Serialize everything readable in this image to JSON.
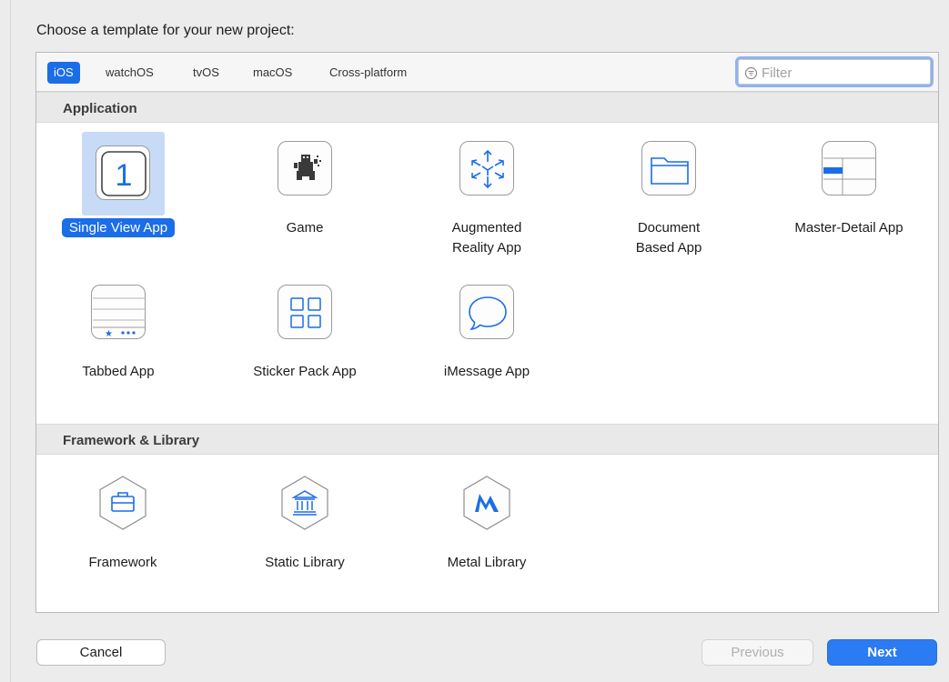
{
  "dialog": {
    "heading": "Choose a template for your new project:"
  },
  "platform_tabs": [
    {
      "label": "iOS",
      "active": true
    },
    {
      "label": "watchOS",
      "active": false
    },
    {
      "label": "tvOS",
      "active": false
    },
    {
      "label": "macOS",
      "active": false
    },
    {
      "label": "Cross-platform",
      "active": false
    }
  ],
  "filter": {
    "placeholder": "Filter",
    "value": ""
  },
  "sections": [
    {
      "title": "Application",
      "templates": [
        {
          "label": "Single View App",
          "icon": "single-view-icon",
          "selected": true
        },
        {
          "label": "Game",
          "icon": "game-icon",
          "selected": false
        },
        {
          "label": "Augmented\nReality App",
          "icon": "augmented-reality-icon",
          "selected": false
        },
        {
          "label": "Document\nBased App",
          "icon": "document-folder-icon",
          "selected": false
        },
        {
          "label": "Master-Detail App",
          "icon": "master-detail-icon",
          "selected": false
        },
        {
          "label": "Tabbed App",
          "icon": "tabbed-app-icon",
          "selected": false
        },
        {
          "label": "Sticker Pack App",
          "icon": "sticker-grid-icon",
          "selected": false
        },
        {
          "label": "iMessage App",
          "icon": "speech-bubble-icon",
          "selected": false
        }
      ]
    },
    {
      "title": "Framework & Library",
      "templates": [
        {
          "label": "Framework",
          "icon": "toolbox-hexagon-icon",
          "selected": false
        },
        {
          "label": "Static Library",
          "icon": "bank-hexagon-icon",
          "selected": false
        },
        {
          "label": "Metal Library",
          "icon": "metal-hexagon-icon",
          "selected": false
        }
      ]
    }
  ],
  "buttons": {
    "cancel": "Cancel",
    "previous": "Previous",
    "next": "Next"
  },
  "colors": {
    "accent": "#1b6de8",
    "selection_bg": "#c7daf6"
  }
}
